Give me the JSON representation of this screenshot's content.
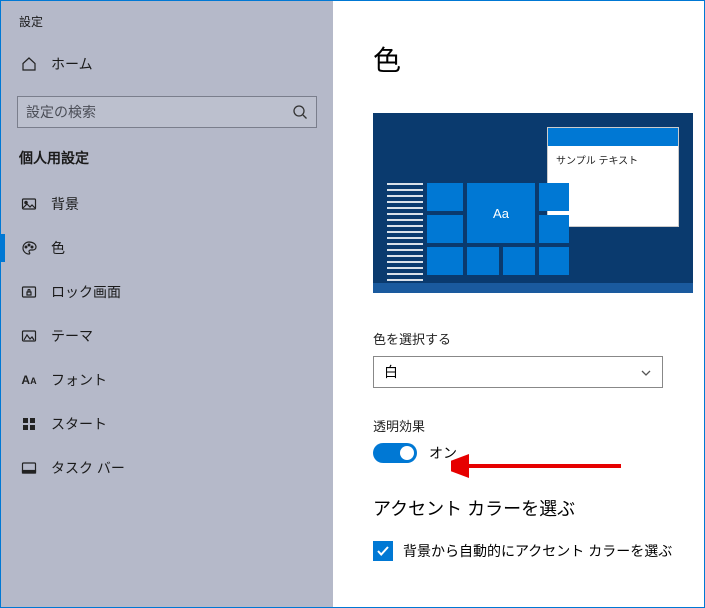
{
  "window": {
    "title": "設定"
  },
  "sidebar": {
    "home_label": "ホーム",
    "search_placeholder": "設定の検索",
    "category": "個人用設定",
    "items": [
      {
        "label": "背景",
        "icon": "image-icon",
        "active": false
      },
      {
        "label": "色",
        "icon": "palette-icon",
        "active": true
      },
      {
        "label": "ロック画面",
        "icon": "lockscreen-icon",
        "active": false
      },
      {
        "label": "テーマ",
        "icon": "theme-icon",
        "active": false
      },
      {
        "label": "フォント",
        "icon": "font-icon",
        "active": false
      },
      {
        "label": "スタート",
        "icon": "start-icon",
        "active": false
      },
      {
        "label": "タスク バー",
        "icon": "taskbar-icon",
        "active": false
      }
    ]
  },
  "main": {
    "title": "色",
    "preview": {
      "sample_text": "サンプル テキスト",
      "tile_label": "Aa"
    },
    "color_mode": {
      "label": "色を選択する",
      "value": "白"
    },
    "transparency": {
      "label": "透明効果",
      "value": "オン",
      "on": true
    },
    "accent_head": "アクセント カラーを選ぶ",
    "auto_accent": {
      "label": "背景から自動的にアクセント カラーを選ぶ",
      "checked": true
    }
  },
  "colors": {
    "accent": "#0078d4",
    "preview_bg": "#0a3a6e"
  }
}
